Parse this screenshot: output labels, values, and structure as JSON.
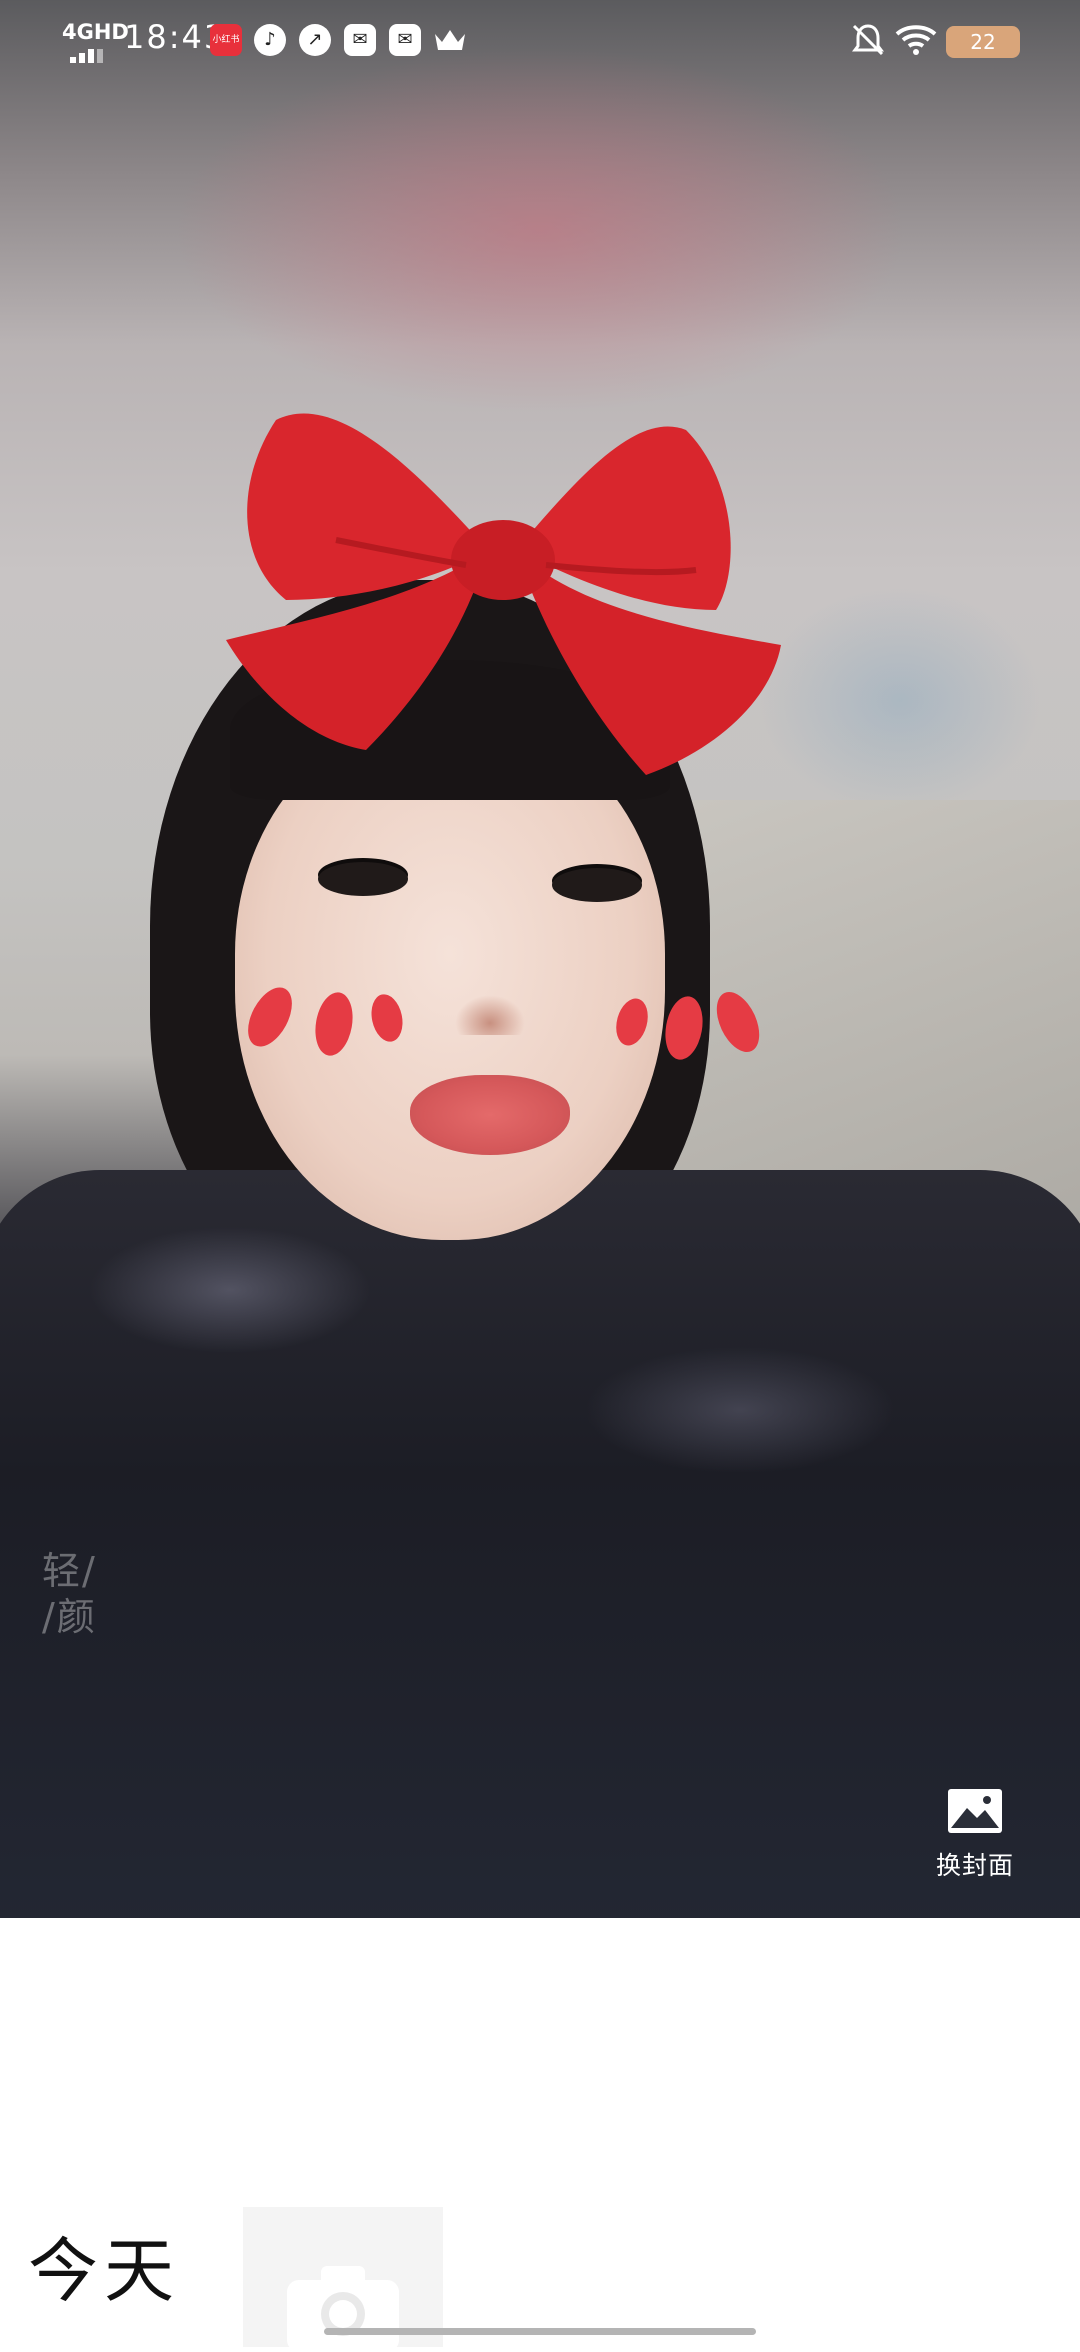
{
  "status_bar": {
    "network": "4GHD",
    "time": "18:43",
    "notification_icons": [
      "xiaohongshu-icon",
      "music-icon",
      "speed-icon",
      "mail-icon",
      "mail-icon",
      "crown-icon"
    ],
    "xiaohongshu_label": "小红书",
    "bell_muted": true,
    "wifi": true,
    "battery": "22",
    "battery_color": "#d9a57a"
  },
  "cover": {
    "watermark": "轻/ /颜",
    "change_cover_label": "换封面",
    "change_cover_icon": "image-icon",
    "accent_color": "#e0232b"
  },
  "diary": {
    "today_label": "今天",
    "add_photo_icon": "camera-icon"
  }
}
